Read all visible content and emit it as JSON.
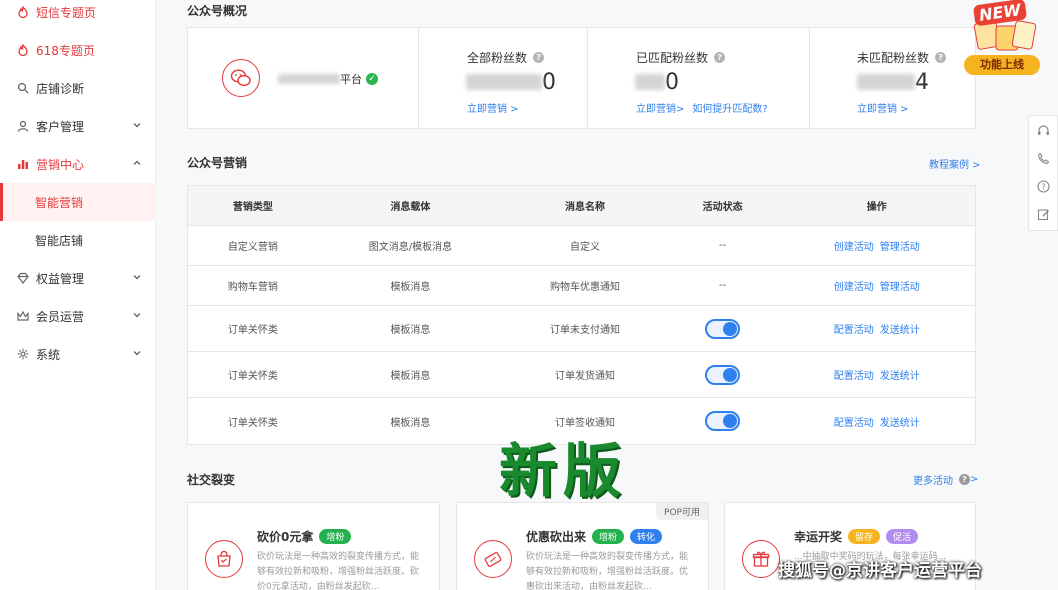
{
  "sidebar": {
    "items": [
      {
        "label": "短信专题页",
        "icon": "flame-icon"
      },
      {
        "label": "618专题页",
        "icon": "flame-icon"
      },
      {
        "label": "店铺诊断",
        "icon": "magnifier-icon"
      },
      {
        "label": "客户管理",
        "icon": "user-icon"
      },
      {
        "label": "营销中心",
        "icon": "bar-chart-icon"
      },
      {
        "label": "智能营销"
      },
      {
        "label": "智能店铺"
      },
      {
        "label": "权益管理",
        "icon": "diamond-icon"
      },
      {
        "label": "会员运营",
        "icon": "crown-icon"
      },
      {
        "label": "系统",
        "icon": "gear-icon"
      }
    ]
  },
  "overview": {
    "title": "公众号概况",
    "account_suffix": "平台",
    "stats": [
      {
        "label": "全部粉丝数",
        "value_tail": "0",
        "links": [
          "立即营销 >"
        ]
      },
      {
        "label": "已匹配粉丝数",
        "value_tail": "0",
        "links": [
          "立即营销>",
          "如何提升匹配数?"
        ]
      },
      {
        "label": "未匹配粉丝数",
        "value_tail": "4",
        "links": [
          "立即营销 >"
        ]
      }
    ]
  },
  "marketing": {
    "title": "公众号营销",
    "tutorial_link": "教程案例 >",
    "headers": [
      "营销类型",
      "消息载体",
      "消息名称",
      "活动状态",
      "操作"
    ],
    "rows": [
      {
        "type": "自定义营销",
        "carrier": "图文消息/模板消息",
        "name": "自定义",
        "status": "--",
        "actions": [
          "创建活动",
          "管理活动"
        ]
      },
      {
        "type": "购物车营销",
        "carrier": "模板消息",
        "name": "购物车优惠通知",
        "status": "--",
        "actions": [
          "创建活动",
          "管理活动"
        ]
      },
      {
        "type": "订单关怀类",
        "carrier": "模板消息",
        "name": "订单未支付通知",
        "status": "on",
        "actions": [
          "配置活动",
          "发送统计"
        ]
      },
      {
        "type": "订单关怀类",
        "carrier": "模板消息",
        "name": "订单发货通知",
        "status": "on",
        "actions": [
          "配置活动",
          "发送统计"
        ]
      },
      {
        "type": "订单关怀类",
        "carrier": "模板消息",
        "name": "订单签收通知",
        "status": "on",
        "actions": [
          "配置活动",
          "发送统计"
        ]
      }
    ]
  },
  "social": {
    "title": "社交裂变",
    "more_link": "更多活动",
    "cards": [
      {
        "title": "砍价0元拿",
        "tags": [
          {
            "text": "增粉",
            "color": "#22b14c"
          }
        ],
        "desc": "砍价玩法是一种高效的裂变传播方式，能够有效拉新和吸粉，增强粉丝活跃度。砍价0元拿活动，由粉丝发起砍...",
        "icon": "bag-icon"
      },
      {
        "title": "优惠砍出来",
        "badge": "POP可用",
        "tags": [
          {
            "text": "增粉",
            "color": "#22b14c"
          },
          {
            "text": "转化",
            "color": "#2f80ed"
          }
        ],
        "desc": "砍价玩法是一种高效的裂变传播方式，能够有效拉新和吸粉，增强粉丝活跃度。优惠砍出来活动，由粉丝发起砍...",
        "icon": "coupon-icon"
      },
      {
        "title": "幸运开奖",
        "tags": [
          {
            "text": "留存",
            "color": "#f5b41f"
          },
          {
            "text": "促活",
            "color": "#b38cf0"
          }
        ],
        "desc": "...中抽取中奖码的玩法，每张幸运码...",
        "icon": "gift-icon"
      }
    ]
  },
  "promo": {
    "new_label": "NEW",
    "launch_label": "功能上线"
  },
  "overlay": {
    "big_text": "新版",
    "footer_text": "搜狐号@京讲客户运营平台"
  },
  "colors": {
    "brand_red": "#e4393c",
    "link_blue": "#2f80ed",
    "toggle_blue": "#2f80ed"
  }
}
